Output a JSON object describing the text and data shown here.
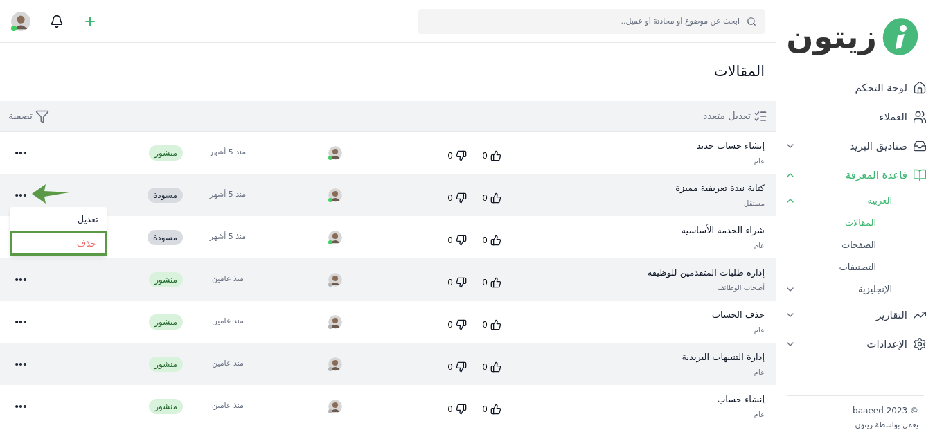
{
  "logo": {
    "text": "زيتون"
  },
  "sidebar": {
    "items": [
      {
        "label": "لوحة التحكم",
        "selected": false
      },
      {
        "label": "العملاء",
        "selected": false
      },
      {
        "label": "صناديق البريد",
        "selected": false,
        "expanded": false
      },
      {
        "label": "قاعدة المعرفة",
        "selected": true,
        "expanded": true,
        "children": [
          {
            "label": "العربية",
            "selected": true,
            "expanded": true,
            "children": [
              {
                "label": "المقالات",
                "selected": true
              },
              {
                "label": "الصفحات",
                "selected": false
              },
              {
                "label": "التصنيفات",
                "selected": false
              }
            ]
          },
          {
            "label": "الإنجليزية",
            "selected": false,
            "expanded": false
          }
        ]
      },
      {
        "label": "التقارير",
        "selected": false,
        "expanded": false
      },
      {
        "label": "الإعدادات",
        "selected": false,
        "expanded": false
      }
    ],
    "footer": [
      "© baaeed 2023",
      "يعمل بواسطة زيتون"
    ]
  },
  "search": {
    "placeholder": "ابحث عن موضوع أو محادثة أو عميل.."
  },
  "page_title": "المقالات",
  "toolbar": {
    "bulk_edit": "تعديل متعدد",
    "filter": "تصفية"
  },
  "rows": [
    {
      "title": "إنشاء حساب جديد",
      "category": "عام",
      "likes": "0",
      "dislikes": "0",
      "online": true,
      "time": "منذ 5 أشهر",
      "status": "منشور",
      "kind": "published"
    },
    {
      "title": "كتابة نبذة تعريفية مميزة",
      "category": "مستقل",
      "likes": "0",
      "dislikes": "0",
      "online": true,
      "time": "منذ 5 أشهر",
      "status": "مسودة",
      "kind": "draft",
      "actions_covered": false
    },
    {
      "title": "شراء الخدمة الأساسية",
      "category": "عام",
      "likes": "0",
      "dislikes": "0",
      "online": true,
      "time": "منذ 5 أشهر",
      "status": "مسودة",
      "kind": "draft",
      "actions_covered": true
    },
    {
      "title": "إدارة طلبات المتقدمين للوظيفة",
      "category": "أصحاب الوظائف",
      "likes": "0",
      "dislikes": "0",
      "online": false,
      "time": "منذ عامين",
      "status": "منشور",
      "kind": "published"
    },
    {
      "title": "حذف الحساب",
      "category": "عام",
      "likes": "0",
      "dislikes": "0",
      "online": false,
      "time": "منذ عامين",
      "status": "منشور",
      "kind": "published"
    },
    {
      "title": "إدارة التنبيهات البريدية",
      "category": "عام",
      "likes": "0",
      "dislikes": "0",
      "online": false,
      "time": "منذ عامين",
      "status": "منشور",
      "kind": "published"
    },
    {
      "title": "إنشاء حساب",
      "category": "عام",
      "likes": "0",
      "dislikes": "0",
      "online": false,
      "time": "منذ عامين",
      "status": "منشور",
      "kind": "published"
    }
  ],
  "menu": {
    "items": [
      {
        "label": "تعديل",
        "kind": "edit",
        "selected": false
      },
      {
        "label": "حذف",
        "kind": "delete",
        "selected": true
      }
    ]
  }
}
